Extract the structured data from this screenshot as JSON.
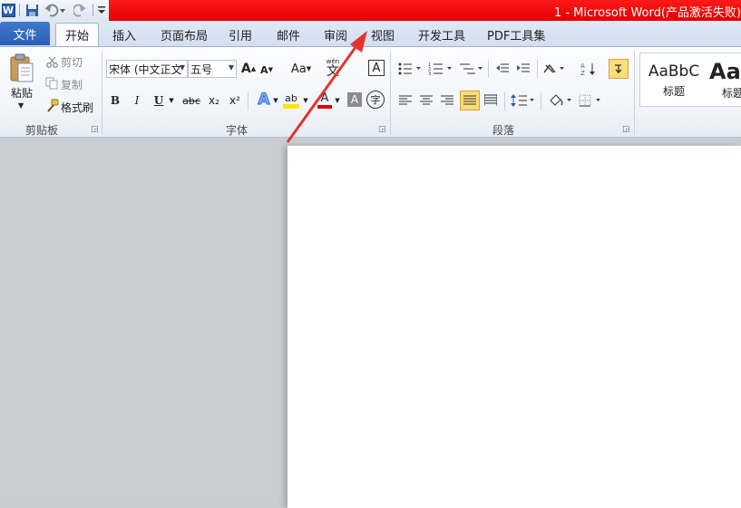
{
  "window": {
    "title": "1 - Microsoft Word(产品激活失败)",
    "app_icon_letter": "W"
  },
  "tabs": {
    "file": "文件",
    "home": "开始",
    "insert": "插入",
    "layout": "页面布局",
    "references": "引用",
    "mailings": "邮件",
    "review": "审阅",
    "view": "视图",
    "developer": "开发工具",
    "pdf": "PDF工具集"
  },
  "clipboard": {
    "paste": "粘贴",
    "cut": "剪切",
    "copy": "复制",
    "format_painter": "格式刷",
    "group_label": "剪贴板"
  },
  "font": {
    "font_name": "宋体 (中文正文",
    "font_size": "五号",
    "grow": "A",
    "shrink": "A",
    "change_case": "Aa",
    "phonetic": "wén",
    "phonetic_char": "文",
    "char_border": "A",
    "bold": "B",
    "italic": "I",
    "underline": "U",
    "strike": "abc",
    "subscript": "x₂",
    "superscript": "x²",
    "text_effect": "A",
    "highlight": "ab",
    "font_color": "A",
    "char_shading": "A",
    "enclose": "字",
    "group_label": "字体"
  },
  "paragraph": {
    "group_label": "段落"
  },
  "styles": {
    "sample1": "AaBbC",
    "label1": "标题",
    "sample2": "Aa",
    "label2": "标题"
  },
  "colors": {
    "title_red": "#e40000",
    "file_tab": "#2a5eb5",
    "arrow": "#e8322e",
    "highlight_yellow": "#ffe500",
    "font_red": "#e00000"
  }
}
